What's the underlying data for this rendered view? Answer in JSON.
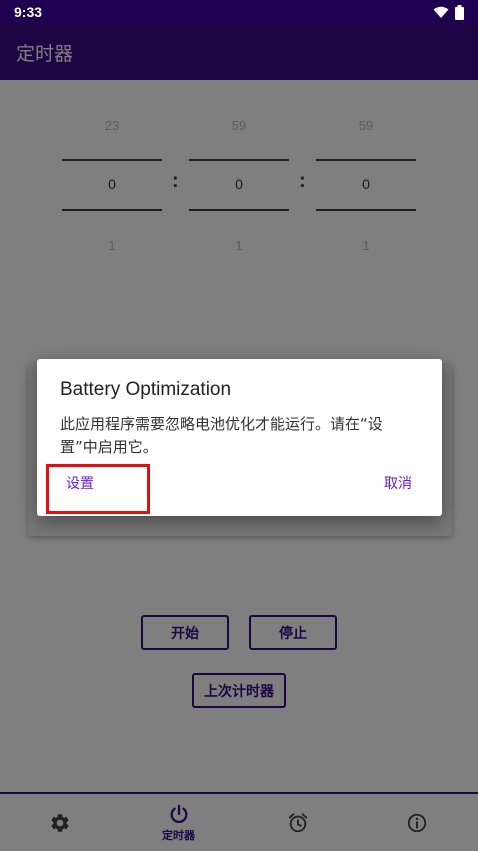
{
  "status_bar": {
    "time": "9:33"
  },
  "app_bar": {
    "title": "定时器"
  },
  "pickers": [
    {
      "prev": "23",
      "current": "0",
      "next": "1"
    },
    {
      "prev": "59",
      "current": "0",
      "next": "1"
    },
    {
      "prev": "59",
      "current": "0",
      "next": "1"
    }
  ],
  "separator": ":",
  "buttons": {
    "start": "开始",
    "stop": "停止",
    "last_timer": "上次计时器"
  },
  "bottom_nav": {
    "timer_label": "定时器"
  },
  "dialog": {
    "title": "Battery Optimization",
    "message": "此应用程序需要忽略电池优化才能运行。请在“设置”中启用它。",
    "positive": "设置",
    "negative": "取消"
  },
  "colors": {
    "primary": "#3a0a86",
    "status_bar": "#1f0050",
    "accent": "#6a1bd6",
    "highlight": "#e01010"
  }
}
